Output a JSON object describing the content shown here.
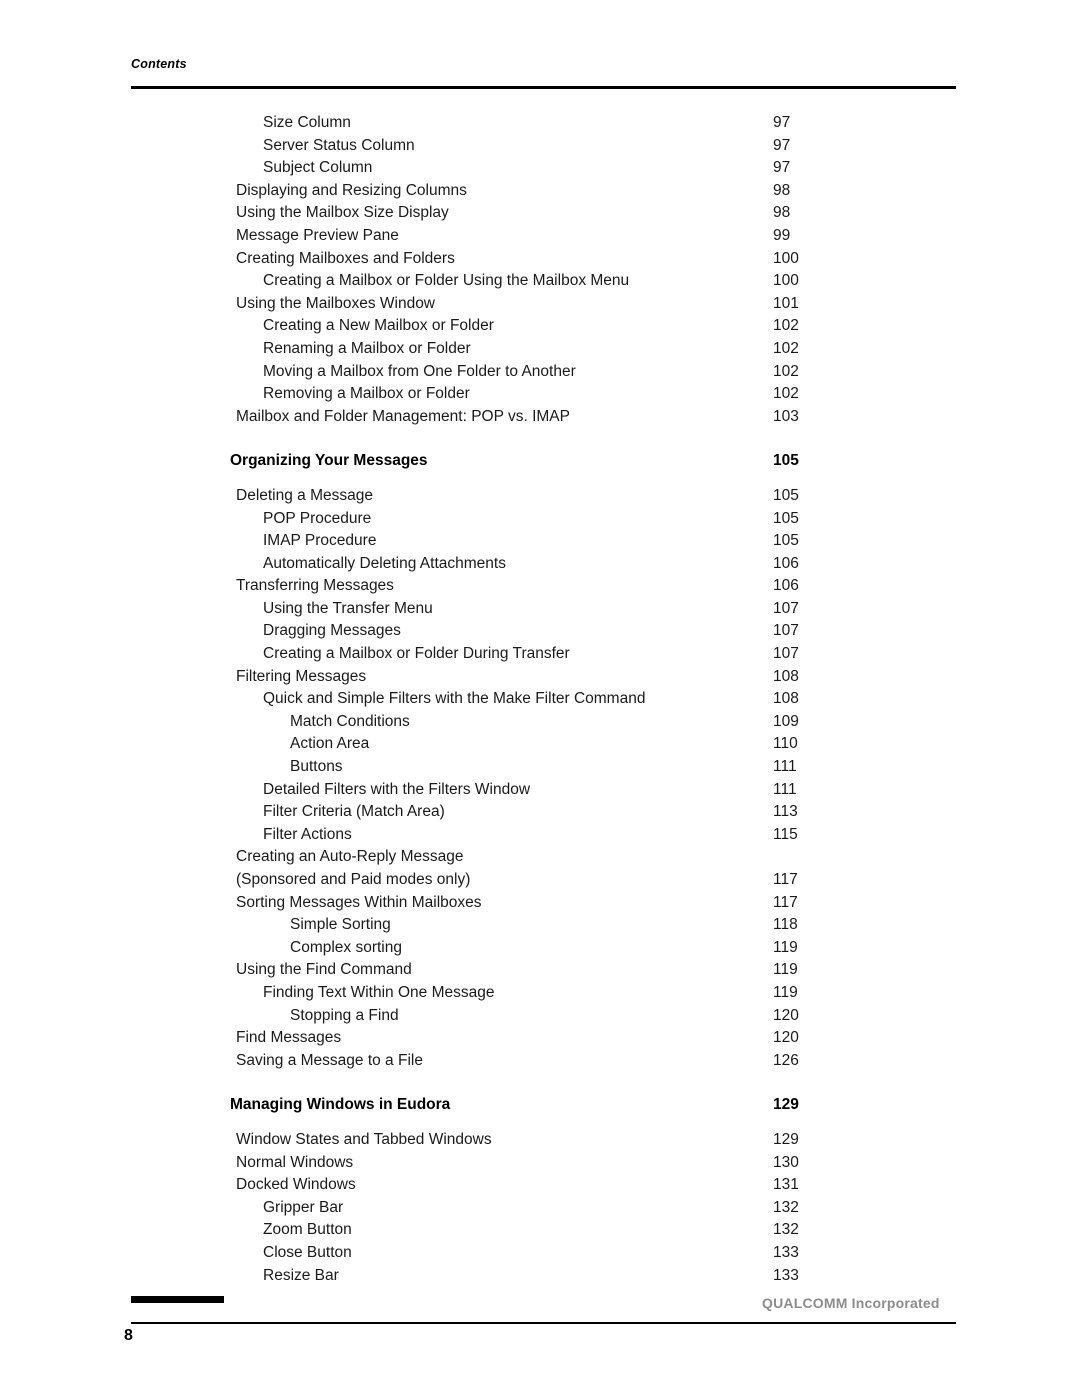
{
  "header": {
    "label": "Contents"
  },
  "footer": {
    "page_number": "8",
    "company": "QUALCOMM Incorporated"
  },
  "toc": {
    "entries": [
      {
        "title": "Size Column",
        "page": "97",
        "level": 1,
        "type": "entry"
      },
      {
        "title": "Server Status Column",
        "page": "97",
        "level": 1,
        "type": "entry"
      },
      {
        "title": "Subject Column",
        "page": "97",
        "level": 1,
        "type": "entry"
      },
      {
        "title": "Displaying and Resizing Columns",
        "page": "98",
        "level": 0,
        "type": "entry"
      },
      {
        "title": "Using the Mailbox Size Display",
        "page": "98",
        "level": 0,
        "type": "entry"
      },
      {
        "title": "Message Preview Pane",
        "page": "99",
        "level": 0,
        "type": "entry"
      },
      {
        "title": "Creating Mailboxes and Folders",
        "page": "100",
        "level": 0,
        "type": "entry"
      },
      {
        "title": "Creating a Mailbox or Folder Using the Mailbox Menu",
        "page": "100",
        "level": 1,
        "type": "entry"
      },
      {
        "title": "Using the Mailboxes Window",
        "page": "101",
        "level": 0,
        "type": "entry"
      },
      {
        "title": "Creating a New Mailbox or Folder",
        "page": "102",
        "level": 1,
        "type": "entry"
      },
      {
        "title": "Renaming a Mailbox or Folder",
        "page": "102",
        "level": 1,
        "type": "entry"
      },
      {
        "title": "Moving a Mailbox from One Folder to Another",
        "page": "102",
        "level": 1,
        "type": "entry"
      },
      {
        "title": "Removing a Mailbox or Folder",
        "page": "102",
        "level": 1,
        "type": "entry"
      },
      {
        "title": "Mailbox and Folder Management: POP vs. IMAP",
        "page": "103",
        "level": 0,
        "type": "entry"
      },
      {
        "title": "Organizing Your Messages",
        "page": "105",
        "level": 0,
        "type": "section"
      },
      {
        "title": "Deleting a Message",
        "page": "105",
        "level": 0,
        "type": "entry"
      },
      {
        "title": "POP Procedure",
        "page": "105",
        "level": 1,
        "type": "entry"
      },
      {
        "title": "IMAP Procedure",
        "page": "105",
        "level": 1,
        "type": "entry"
      },
      {
        "title": "Automatically Deleting Attachments",
        "page": "106",
        "level": 1,
        "type": "entry"
      },
      {
        "title": "Transferring Messages",
        "page": "106",
        "level": 0,
        "type": "entry"
      },
      {
        "title": "Using the Transfer Menu",
        "page": "107",
        "level": 1,
        "type": "entry"
      },
      {
        "title": "Dragging Messages",
        "page": "107",
        "level": 1,
        "type": "entry"
      },
      {
        "title": "Creating a Mailbox or Folder During Transfer",
        "page": "107",
        "level": 1,
        "type": "entry"
      },
      {
        "title": "Filtering Messages",
        "page": "108",
        "level": 0,
        "type": "entry"
      },
      {
        "title": "Quick and Simple Filters with the Make Filter Command",
        "page": "108",
        "level": 1,
        "type": "entry"
      },
      {
        "title": "Match Conditions",
        "page": "109",
        "level": 2,
        "type": "entry"
      },
      {
        "title": "Action Area",
        "page": "110",
        "level": 2,
        "type": "entry"
      },
      {
        "title": "Buttons",
        "page": "111",
        "level": 2,
        "type": "entry"
      },
      {
        "title": "Detailed Filters with the Filters Window",
        "page": "111",
        "level": 1,
        "type": "entry"
      },
      {
        "title": "Filter Criteria (Match Area)",
        "page": "113",
        "level": 1,
        "type": "entry"
      },
      {
        "title": "Filter Actions",
        "page": "115",
        "level": 1,
        "type": "entry"
      },
      {
        "title": "Creating an Auto-Reply Message",
        "page": "",
        "level": 0,
        "type": "entry"
      },
      {
        "title": "(Sponsored and Paid modes only)",
        "page": "117",
        "level": 0,
        "type": "entry"
      },
      {
        "title": "Sorting Messages Within Mailboxes",
        "page": "117",
        "level": 0,
        "type": "entry"
      },
      {
        "title": "Simple Sorting",
        "page": "118",
        "level": 2,
        "type": "entry"
      },
      {
        "title": "Complex sorting",
        "page": "119",
        "level": 2,
        "type": "entry"
      },
      {
        "title": "Using the Find Command",
        "page": "119",
        "level": 0,
        "type": "entry"
      },
      {
        "title": "Finding Text Within One Message",
        "page": "119",
        "level": 1,
        "type": "entry"
      },
      {
        "title": "Stopping a Find",
        "page": "120",
        "level": 2,
        "type": "entry"
      },
      {
        "title": "Find Messages",
        "page": "120",
        "level": 0,
        "type": "entry"
      },
      {
        "title": "Saving a Message to a File",
        "page": "126",
        "level": 0,
        "type": "entry"
      },
      {
        "title": "Managing Windows in Eudora",
        "page": "129",
        "level": 0,
        "type": "section"
      },
      {
        "title": "Window States and Tabbed Windows",
        "page": "129",
        "level": 0,
        "type": "entry"
      },
      {
        "title": "Normal Windows",
        "page": "130",
        "level": 0,
        "type": "entry"
      },
      {
        "title": "Docked Windows",
        "page": "131",
        "level": 0,
        "type": "entry"
      },
      {
        "title": "Gripper Bar",
        "page": "132",
        "level": 1,
        "type": "entry"
      },
      {
        "title": "Zoom Button",
        "page": "132",
        "level": 1,
        "type": "entry"
      },
      {
        "title": "Close Button",
        "page": "133",
        "level": 1,
        "type": "entry"
      },
      {
        "title": "Resize Bar",
        "page": "133",
        "level": 1,
        "type": "entry"
      }
    ]
  }
}
